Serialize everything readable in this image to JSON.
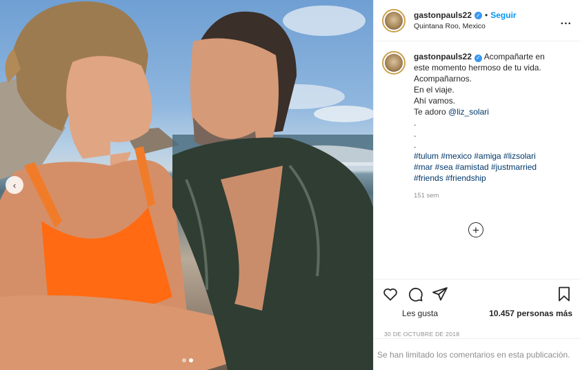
{
  "post": {
    "username": "gastonpauls22",
    "follow_label": "Seguir",
    "separator": "•",
    "location": "Quintana Roo, Mexico",
    "more_label": "...",
    "caption_lines": [
      "Acompañarte en",
      "este momento hermoso de tu vida.",
      "Acompañarnos.",
      "En el viaje.",
      "Ahí vamos."
    ],
    "caption_mention_prefix": "Te adoro ",
    "caption_mention": "@liz_solari",
    "dots": [
      ".",
      ".",
      "."
    ],
    "hashtag_lines": [
      "#tulum #mexico #amiga #lizsolari",
      "#mar #sea #amistad #justmarried",
      "#friends #friendship"
    ],
    "time_ago": "151 sem",
    "plus_label": "+",
    "likes_label": "Les gusta",
    "likes_count": "10.457 personas más",
    "date": "30 DE OCTUBRE DE 2018",
    "comments_limited": "Se han limitado los comentarios en esta publicación."
  },
  "carousel": {
    "prev_label": "‹",
    "dots": 2,
    "active_dot": 1
  },
  "icons": [
    "heart-icon",
    "comment-icon",
    "share-icon",
    "bookmark-icon",
    "verified-icon",
    "more-options-icon",
    "add-comment-icon"
  ],
  "colors": {
    "link": "#0095f6",
    "verified": "#3897f0",
    "muted": "#8e8e8e",
    "border": "#efefef"
  }
}
